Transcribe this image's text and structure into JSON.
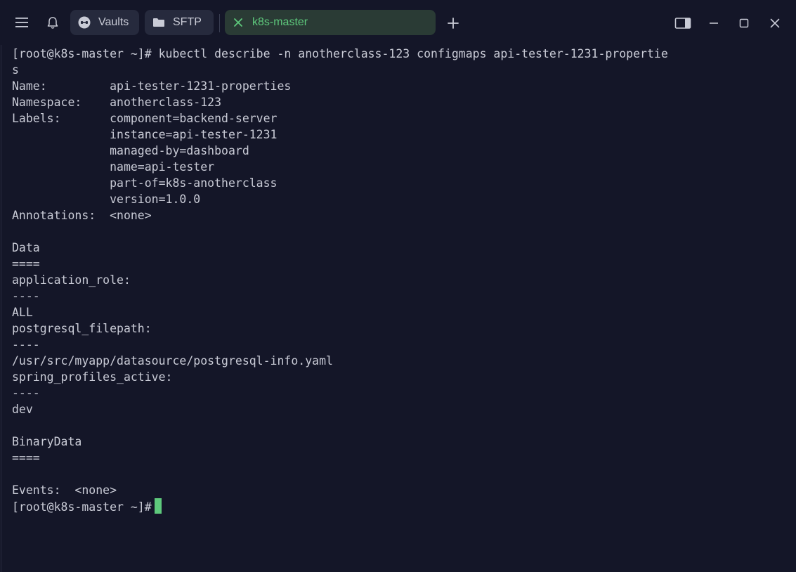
{
  "tabs": [
    {
      "label": "Vaults",
      "icon": "vault-icon"
    },
    {
      "label": "SFTP",
      "icon": "folder-icon"
    },
    {
      "label": "k8s-master",
      "icon": "close-icon",
      "active": true
    }
  ],
  "colors": {
    "background": "#141628",
    "text": "#c9cbd6",
    "accent": "#5ec97c",
    "tab": "#262a3d",
    "active_tab": "#2a3b35"
  },
  "terminal": {
    "lines": [
      "[root@k8s-master ~]# kubectl describe -n anotherclass-123 configmaps api-tester-1231-propertie",
      "s",
      "Name:         api-tester-1231-properties",
      "Namespace:    anotherclass-123",
      "Labels:       component=backend-server",
      "              instance=api-tester-1231",
      "              managed-by=dashboard",
      "              name=api-tester",
      "              part-of=k8s-anotherclass",
      "              version=1.0.0",
      "Annotations:  <none>",
      "",
      "Data",
      "====",
      "application_role:",
      "----",
      "ALL",
      "postgresql_filepath:",
      "----",
      "/usr/src/myapp/datasource/postgresql-info.yaml",
      "spring_profiles_active:",
      "----",
      "dev",
      "",
      "BinaryData",
      "====",
      "",
      "Events:  <none>"
    ],
    "prompt": "[root@k8s-master ~]# "
  }
}
